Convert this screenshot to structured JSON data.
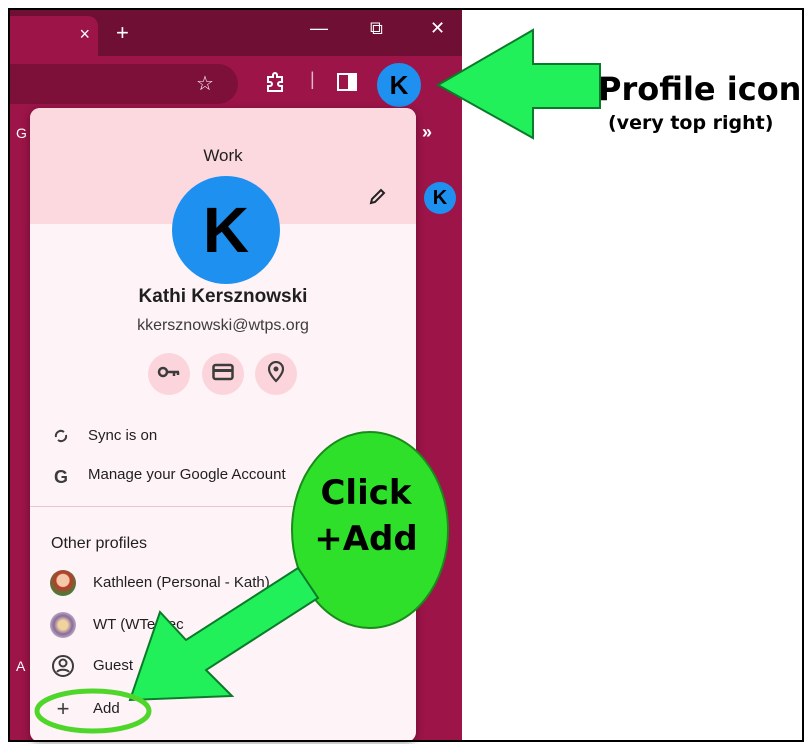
{
  "browser": {
    "tab_close": "×",
    "new_tab": "+",
    "window_controls": {
      "minimize": "—",
      "restore": "⧉",
      "close": "✕"
    },
    "star_icon": "☆",
    "bookmark_partial_letter": "G",
    "bookmarks_more": "»",
    "side_partial_letter": "A",
    "avatar_letter": "K"
  },
  "profile_menu": {
    "profile_name_label": "Work",
    "avatar_letter": "K",
    "user_name": "Kathi Kersznowski",
    "email": "kkersznowski@wtps.org",
    "quick_buttons": [
      "key-icon",
      "credit-card-icon",
      "location-pin-icon"
    ],
    "sync_label": "Sync is on",
    "manage_label": "Manage your Google Account",
    "other_profiles_title": "Other profiles",
    "other_profiles": [
      {
        "label": "Kathleen (Personal - Kath)"
      },
      {
        "label": "WT (WTedtec"
      },
      {
        "label": "Guest"
      }
    ],
    "add_label": "Add"
  },
  "annotations": {
    "callout_title": "Profile icon",
    "callout_subtitle": "(very top right)",
    "bubble_line1": "Click",
    "bubble_line2": "+Add",
    "arrow_color": "#22f05a",
    "bubble_color": "#2ee02a",
    "highlight_color": "#4fd62a"
  },
  "colors": {
    "browser_frame": "#9c1448",
    "popup_header": "#fcd9df",
    "popup_body": "#fef3f6",
    "avatar_blue": "#1e90f0"
  }
}
